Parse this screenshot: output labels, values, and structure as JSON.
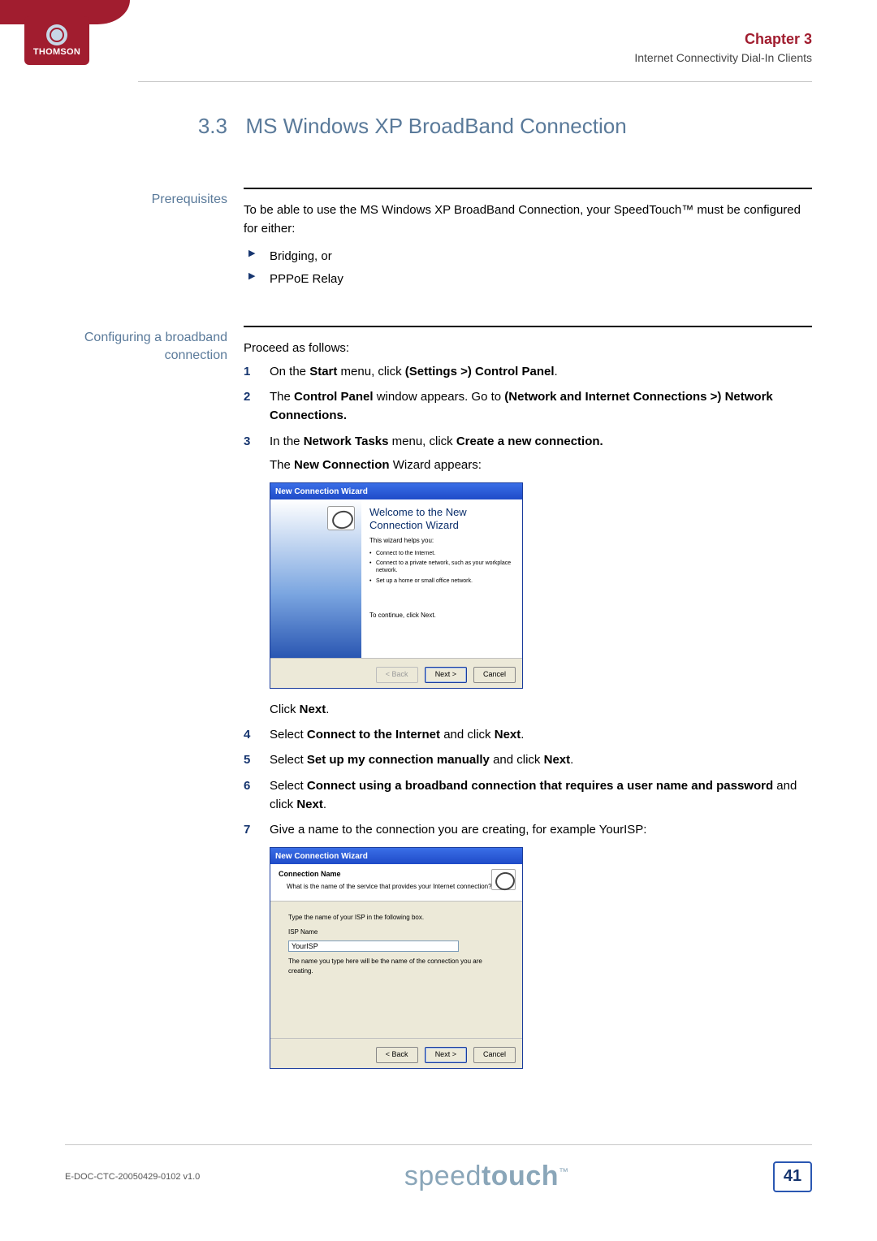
{
  "header": {
    "logo_text": "THOMSON",
    "chapter": "Chapter 3",
    "subtitle": "Internet Connectivity Dial-In Clients"
  },
  "section": {
    "number": "3.3",
    "title": "MS Windows XP BroadBand Connection"
  },
  "prereq": {
    "label": "Prerequisites",
    "intro": "To be able to use the MS Windows XP BroadBand Connection, your SpeedTouch™ must be configured for either:",
    "items": [
      "Bridging, or",
      "PPPoE Relay"
    ]
  },
  "config": {
    "label": "Configuring a broadband connection",
    "lead": "Proceed as follows:",
    "step1_a": "On the ",
    "step1_b": "Start",
    "step1_c": " menu, click ",
    "step1_d": "(Settings >) Control Panel",
    "step1_e": ".",
    "step2_a": "The ",
    "step2_b": "Control Panel",
    "step2_c": " window appears. Go to ",
    "step2_d": "(Network and Internet Connections >) Network Connections.",
    "step3_a": "In the ",
    "step3_b": "Network Tasks",
    "step3_c": " menu, click ",
    "step3_d": "Create a new connection.",
    "step3_sub_a": "The ",
    "step3_sub_b": "New Connection",
    "step3_sub_c": " Wizard appears:",
    "after_wiz1_a": "Click ",
    "after_wiz1_b": "Next",
    "after_wiz1_c": ".",
    "step4_a": "Select ",
    "step4_b": "Connect to the Internet",
    "step4_c": " and click ",
    "step4_d": "Next",
    "step4_e": ".",
    "step5_a": "Select ",
    "step5_b": "Set up my connection manually",
    "step5_c": " and click ",
    "step5_d": "Next",
    "step5_e": ".",
    "step6_a": "Select ",
    "step6_b": "Connect using a broadband connection that requires a user name and password",
    "step6_c": " and click ",
    "step6_d": "Next",
    "step6_e": ".",
    "step7": "Give a name to the connection you are creating, for example YourISP:"
  },
  "wizard1": {
    "titlebar": "New Connection Wizard",
    "welcome": "Welcome to the New Connection Wizard",
    "helps": "This wizard helps you:",
    "items": [
      "Connect to the Internet.",
      "Connect to a private network, such as your workplace network.",
      "Set up a home or small office network."
    ],
    "continue": "To continue, click Next.",
    "back": "< Back",
    "next": "Next >",
    "cancel": "Cancel"
  },
  "wizard2": {
    "titlebar": "New Connection Wizard",
    "heading": "Connection Name",
    "subheading": "What is the name of the service that provides your Internet connection?",
    "prompt": "Type the name of your ISP in the following box.",
    "field_label": "ISP Name",
    "field_value": "YourISP",
    "hint": "The name you type here will be the name of the connection you are creating.",
    "back": "< Back",
    "next": "Next >",
    "cancel": "Cancel"
  },
  "footer": {
    "doc_id": "E-DOC-CTC-20050429-0102 v1.0",
    "brand_a": "speed",
    "brand_b": "touch",
    "tm": "™",
    "page": "41"
  }
}
